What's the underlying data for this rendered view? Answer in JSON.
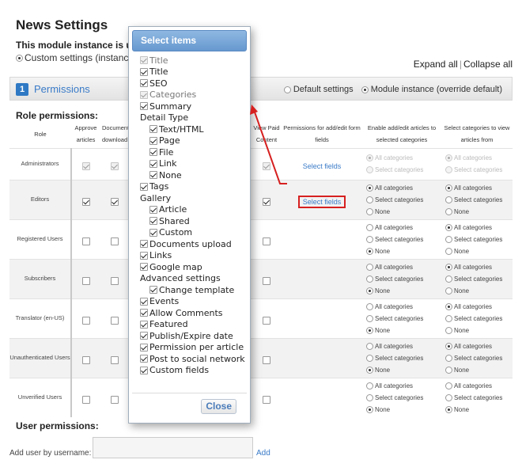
{
  "page": {
    "title": "News Settings",
    "instance_text": "This module instance is u",
    "custom_settings": "Custom settings (instance",
    "expand_all": "Expand all",
    "separator": "|",
    "collapse_all": "Collapse all"
  },
  "permissions": {
    "number": "1",
    "title": "Permissions",
    "default_option": "Default settings",
    "module_option": "Module instance (override default)",
    "selected_option": "Module instance (override default)"
  },
  "role_section": {
    "title": "Role permissions:",
    "headers": {
      "role": "Role",
      "approve": "Approve articles",
      "documents": "Documents download",
      "view_paid": "View Paid Content",
      "form_fields": "Permissions for add/edit form fields",
      "enable_add": "Enable add/edit articles to selected categories",
      "select_view": "Select categories to view articles from"
    },
    "option_labels": {
      "all": "All categories",
      "select": "Select categories",
      "none": "None"
    },
    "link_label": "Select fields",
    "rows": [
      {
        "name": "Administrators",
        "approve": true,
        "documents": true,
        "view_paid": true,
        "disabled": true,
        "has_link": true,
        "highlight": false,
        "enable_add": "all",
        "select_view": "all"
      },
      {
        "name": "Editors",
        "approve": true,
        "documents": true,
        "view_paid": true,
        "disabled": false,
        "has_link": true,
        "highlight": true,
        "enable_add": "all",
        "select_view": "all"
      },
      {
        "name": "Registered Users",
        "approve": false,
        "documents": false,
        "view_paid": false,
        "disabled": false,
        "has_link": false,
        "highlight": false,
        "enable_add": "none",
        "select_view": "all"
      },
      {
        "name": "Subscribers",
        "approve": false,
        "documents": false,
        "view_paid": false,
        "disabled": false,
        "has_link": false,
        "highlight": false,
        "enable_add": "none",
        "select_view": "all"
      },
      {
        "name": "Translator (en-US)",
        "approve": false,
        "documents": false,
        "view_paid": false,
        "disabled": false,
        "has_link": false,
        "highlight": false,
        "enable_add": "none",
        "select_view": "all"
      },
      {
        "name": "Unauthenticated Users",
        "approve": false,
        "documents": false,
        "view_paid": false,
        "disabled": false,
        "has_link": false,
        "highlight": false,
        "enable_add": "none",
        "select_view": "all"
      },
      {
        "name": "Unverified Users",
        "approve": false,
        "documents": false,
        "view_paid": false,
        "disabled": false,
        "has_link": false,
        "highlight": false,
        "enable_add": "none",
        "select_view": "none"
      }
    ]
  },
  "user_section": {
    "title": "User permissions:",
    "add_label": "Add user by username:",
    "add_value": "",
    "add_link": "Add"
  },
  "popup": {
    "title": "Select items",
    "close_label": "Close",
    "items": [
      {
        "label": "Title",
        "type": "check",
        "checked": true,
        "disabled": true
      },
      {
        "label": "Title",
        "type": "check",
        "checked": true
      },
      {
        "label": "SEO",
        "type": "check",
        "checked": true
      },
      {
        "label": "Categories",
        "type": "check",
        "checked": true,
        "disabled": true
      },
      {
        "label": "Summary",
        "type": "check",
        "checked": true
      },
      {
        "label": "Detail Type",
        "type": "heading"
      },
      {
        "label": "Text/HTML",
        "type": "check",
        "checked": true,
        "indent": true
      },
      {
        "label": "Page",
        "type": "check",
        "checked": true,
        "indent": true
      },
      {
        "label": "File",
        "type": "check",
        "checked": true,
        "indent": true
      },
      {
        "label": "Link",
        "type": "check",
        "checked": true,
        "indent": true
      },
      {
        "label": "None",
        "type": "check",
        "checked": true,
        "indent": true
      },
      {
        "label": "Tags",
        "type": "check",
        "checked": true
      },
      {
        "label": "Gallery",
        "type": "heading"
      },
      {
        "label": "Article",
        "type": "check",
        "checked": true,
        "indent": true
      },
      {
        "label": "Shared",
        "type": "check",
        "checked": true,
        "indent": true
      },
      {
        "label": "Custom",
        "type": "check",
        "checked": true,
        "indent": true
      },
      {
        "label": "Documents upload",
        "type": "check",
        "checked": true
      },
      {
        "label": "Links",
        "type": "check",
        "checked": true
      },
      {
        "label": "Google map",
        "type": "check",
        "checked": true
      },
      {
        "label": "Advanced settings",
        "type": "heading"
      },
      {
        "label": "Change template",
        "type": "check",
        "checked": true,
        "indent": true
      },
      {
        "label": "Events",
        "type": "check",
        "checked": true
      },
      {
        "label": "Allow Comments",
        "type": "check",
        "checked": true
      },
      {
        "label": "Featured",
        "type": "check",
        "checked": true
      },
      {
        "label": "Publish/Expire date",
        "type": "check",
        "checked": true
      },
      {
        "label": "Permission per article",
        "type": "check",
        "checked": true
      },
      {
        "label": "Post to social network",
        "type": "check",
        "checked": true
      },
      {
        "label": "Custom fields",
        "type": "check",
        "checked": true
      }
    ]
  },
  "annotation": {
    "color": "#d62020"
  }
}
